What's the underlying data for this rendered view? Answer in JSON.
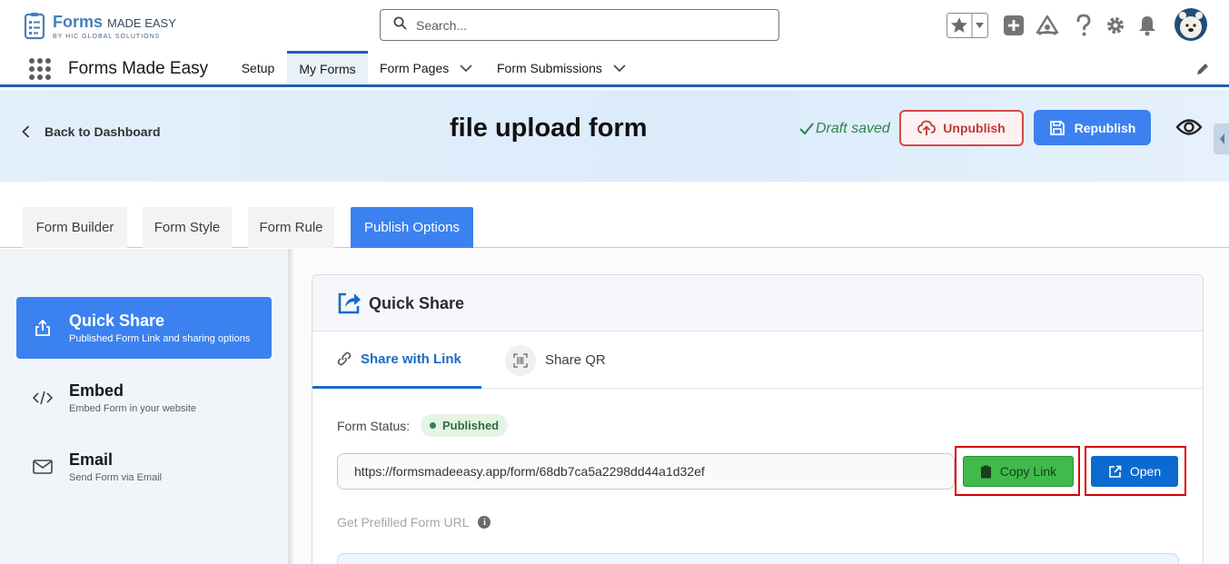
{
  "global_header": {
    "logo_forms": "Forms",
    "logo_made_easy": "MADE EASY",
    "logo_sub": "BY HIC GLOBAL SOLUTIONS",
    "search_placeholder": "Search..."
  },
  "app_nav": {
    "app_name": "Forms Made Easy",
    "items": [
      {
        "label": "Setup"
      },
      {
        "label": "My Forms"
      },
      {
        "label": "Form Pages"
      },
      {
        "label": "Form Submissions"
      }
    ],
    "active": "My Forms"
  },
  "form_header": {
    "back_label": "Back to Dashboard",
    "title": "file upload form",
    "draft_status": "Draft saved",
    "unpublish_label": "Unpublish",
    "republish_label": "Republish"
  },
  "tabs": [
    {
      "label": "Form Builder"
    },
    {
      "label": "Form Style"
    },
    {
      "label": "Form Rule"
    },
    {
      "label": "Publish Options"
    }
  ],
  "active_tab": "Publish Options",
  "side_menu": [
    {
      "title": "Quick Share",
      "subtitle": "Published Form Link and sharing options",
      "icon": "share-upload-icon"
    },
    {
      "title": "Embed",
      "subtitle": "Embed Form in your website",
      "icon": "code-icon"
    },
    {
      "title": "Email",
      "subtitle": "Send Form via Email",
      "icon": "mail-icon"
    }
  ],
  "quick_share": {
    "title": "Quick Share",
    "subtabs": [
      {
        "label": "Share with Link",
        "icon": "link-icon"
      },
      {
        "label": "Share QR",
        "icon": "qr-icon"
      }
    ],
    "status_label": "Form Status:",
    "status_value": "Published",
    "url": "https://formsmadeeasy.app/form/68db7ca5a2298dd44a1d32ef",
    "copy_label": "Copy Link",
    "open_label": "Open",
    "prefill_label": "Get Prefilled Form URL",
    "info_glyph": "i"
  },
  "colors": {
    "brand_blue": "#3b82f0",
    "nav_blue": "#1b5fb5",
    "published_green": "#2e844a",
    "danger_red": "#c23934",
    "copy_green": "#3fba4b",
    "open_blue": "#0b6ad0",
    "highlight_red": "#d40000"
  }
}
